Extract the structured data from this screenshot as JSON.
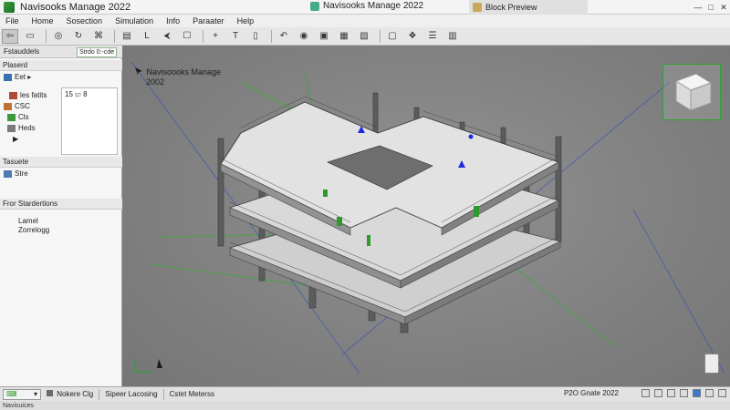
{
  "window": {
    "title": "Navisooks Manage 2022",
    "center_title": "Navisooks Manage 2022",
    "right_title": "Block Preview",
    "controls": [
      "—",
      "□",
      "✕"
    ]
  },
  "menu": [
    "File",
    "Home",
    "Sosection",
    "Simulation",
    "Info",
    "Paraater",
    "Help"
  ],
  "toolbar": {
    "buttons": [
      {
        "icon": "select-icon",
        "glyph": "⇦",
        "active": true
      },
      {
        "icon": "box-select-icon",
        "glyph": "▭"
      },
      {
        "icon": "globe-icon",
        "glyph": "◎"
      },
      {
        "icon": "orbit-icon",
        "glyph": "↻"
      },
      {
        "icon": "zoom-icon",
        "glyph": "⌘"
      },
      {
        "icon": "document-icon",
        "glyph": "▤"
      },
      {
        "icon": "line-icon",
        "glyph": "L"
      },
      {
        "icon": "pan-icon",
        "glyph": "⮜"
      },
      {
        "icon": "clipboard-icon",
        "glyph": "☐"
      },
      {
        "icon": "plus-icon",
        "glyph": "+"
      },
      {
        "icon": "text-icon",
        "glyph": "T"
      },
      {
        "icon": "page-icon",
        "glyph": "▯"
      },
      {
        "icon": "undo-icon",
        "glyph": "↶"
      },
      {
        "icon": "camera-icon",
        "glyph": "◉"
      },
      {
        "icon": "frame-icon",
        "glyph": "▣"
      },
      {
        "icon": "record-icon",
        "glyph": "▦"
      },
      {
        "icon": "palette-icon",
        "glyph": "▧"
      },
      {
        "icon": "window-icon",
        "glyph": "▢"
      },
      {
        "icon": "tree-icon",
        "glyph": "❖"
      },
      {
        "icon": "list-icon",
        "glyph": "☰"
      },
      {
        "icon": "panel-icon",
        "glyph": "▥"
      }
    ]
  },
  "left_panel": {
    "tab_label": "Fstauddels",
    "pin_glyph": "✕",
    "section1": "Plaserd",
    "tree": [
      {
        "label": "Eet ▸",
        "color": "#3a6fb0"
      },
      {
        "label": "les fatits",
        "color": "#b24a3a"
      },
      {
        "label": "CSC",
        "color": "#c07030"
      },
      {
        "label": "Cls",
        "color": "#3a9a3a"
      },
      {
        "label": "Heds",
        "color": "#7a7a7a"
      },
      {
        "label": "▶",
        "color": "#333"
      }
    ],
    "props_title": "15 ඟ 8",
    "section2": "Tasuete",
    "site_label": "Stre",
    "section3": "Fror Stardertions",
    "sub_items": [
      "Lamel",
      "Zorrelogg"
    ]
  },
  "viewport": {
    "tab_label": "Strdo 0:-cde",
    "caption_line1": "Navisoooks Manage",
    "caption_line2": "2002"
  },
  "bottom_bar": {
    "dropdown_value": "",
    "items": [
      "Nokere Clg",
      "Sipeer Lacosing",
      "Cstet Meterss"
    ],
    "status_label": "P2O Gnate 2022"
  },
  "status_bar": {
    "text": "Navisuices"
  },
  "colors": {
    "accent_green": "#2fa12f",
    "marker_blue": "#1a2ee0",
    "viewport_bg": "#858585"
  }
}
